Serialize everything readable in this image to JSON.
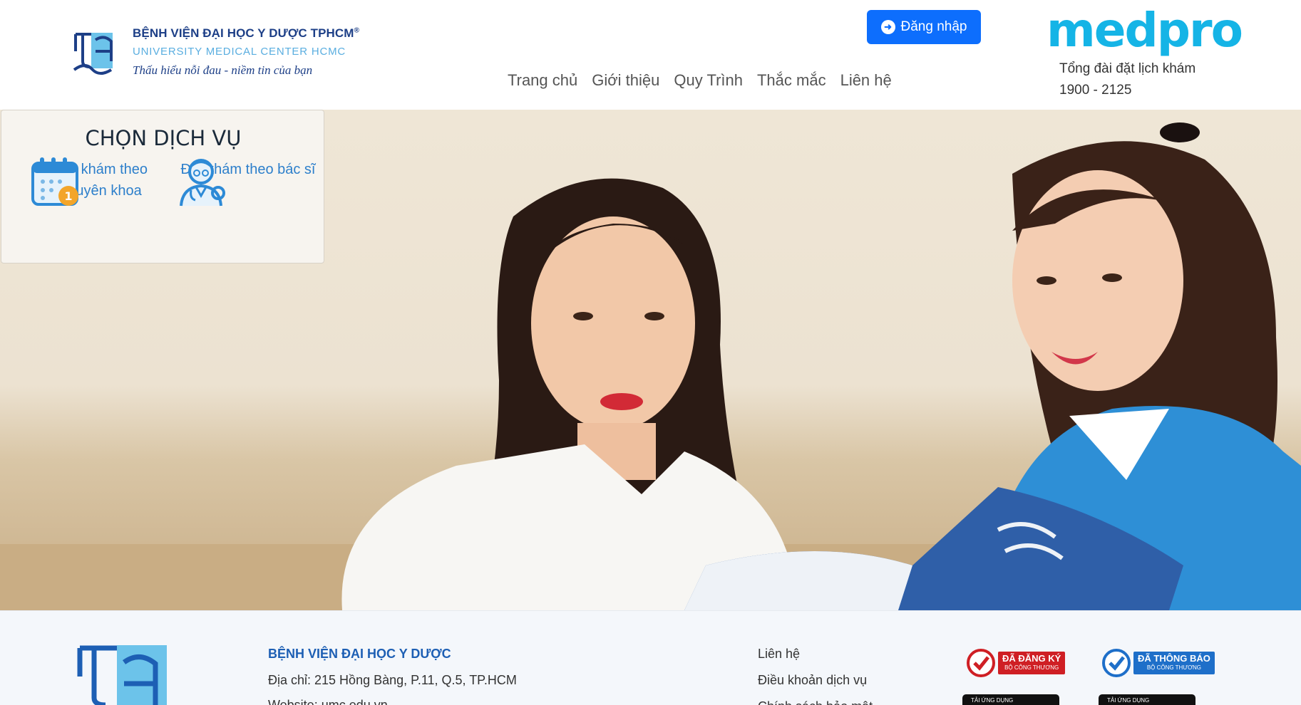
{
  "header": {
    "hospital_name": "BỆNH VIỆN ĐẠI HỌC Y DƯỢC TPHCM",
    "registered_mark": "®",
    "hospital_name_en": "UNIVERSITY MEDICAL CENTER HCMC",
    "slogan": "Thấu hiểu nỗi đau - niềm tin của bạn",
    "login_label": "Đăng nhập",
    "nav": [
      "Trang chủ",
      "Giới thiệu",
      "Quy Trình",
      "Thắc mắc",
      "Liên hệ"
    ],
    "brand": "medpro",
    "hotline_label": "Tổng đài đặt lịch khám",
    "hotline_number": "1900 - 2125"
  },
  "services": {
    "title": "CHỌN DỊCH VỤ",
    "items": [
      {
        "label": "Đặt khám theo chuyên khoa",
        "icon": "calendar-icon"
      },
      {
        "label": "Đặt khám theo bác sĩ",
        "icon": "doctor-icon"
      }
    ]
  },
  "footer": {
    "name": "BỆNH VIỆN ĐẠI HỌC Y DƯỢC",
    "address": "Địa chỉ: 215 Hồng Bàng, P.11, Q.5, TP.HCM",
    "website": "Website: umc.edu.vn",
    "links": [
      "Liên hệ",
      "Điều khoản dịch vụ",
      "Chính sách bảo mật"
    ],
    "badge_registered": "ĐÃ ĐĂNG KÝ",
    "badge_notified": "ĐÃ THÔNG BÁO",
    "badge_sub": "BỘ CÔNG THƯƠNG",
    "store_label": "TẢI ỨNG DỤNG"
  },
  "colors": {
    "primary": "#0d6efd",
    "brand": "#15b4e6",
    "hospital_blue": "#1d3f87",
    "link_blue": "#2d7fcb"
  }
}
